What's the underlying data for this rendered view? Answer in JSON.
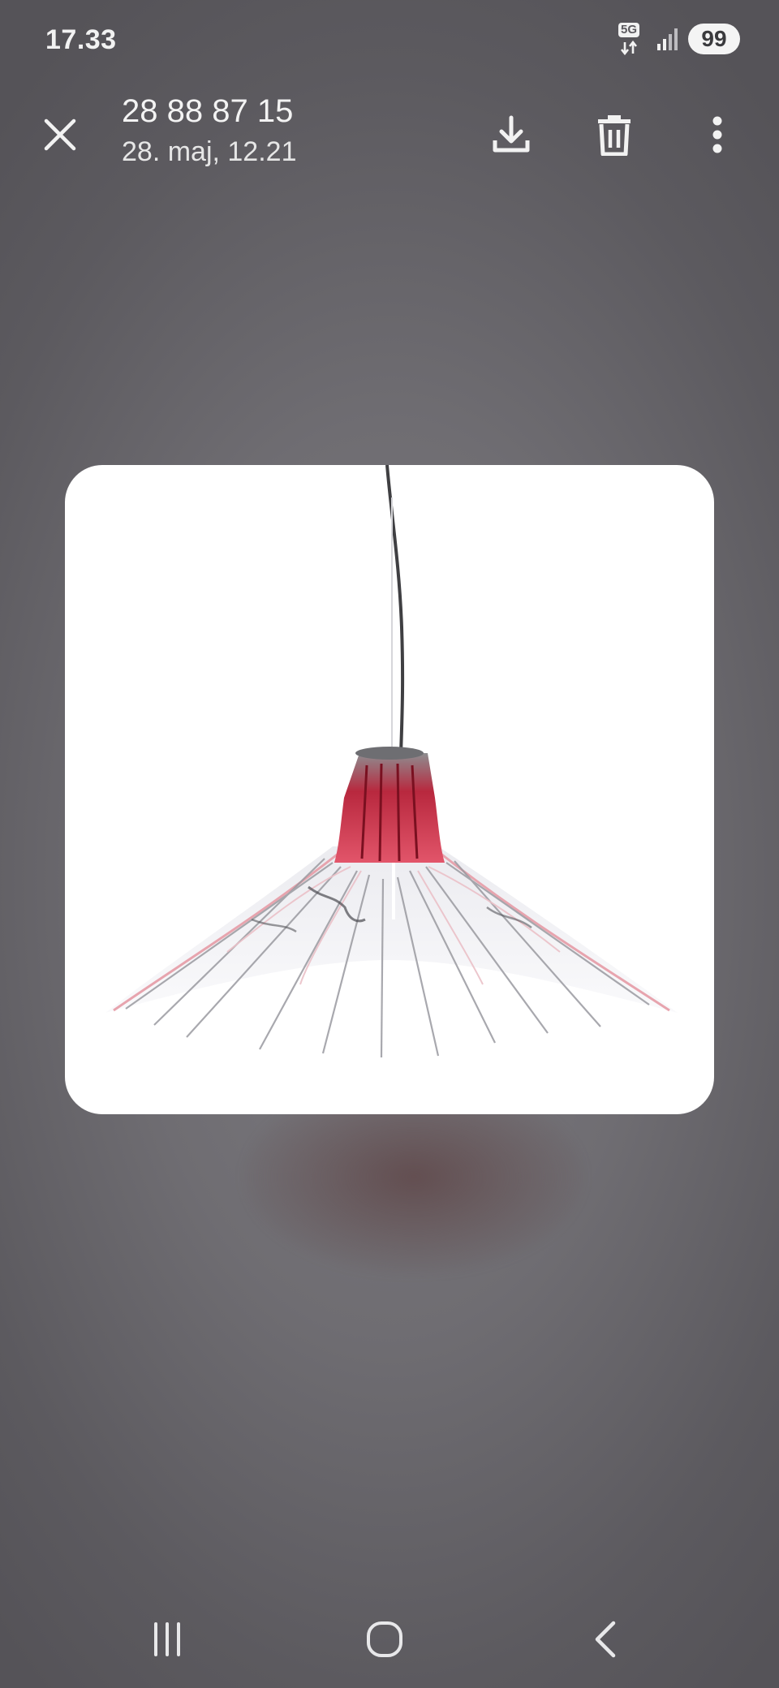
{
  "status_bar": {
    "time": "17.33",
    "network_type": "5G",
    "battery_level": "99",
    "icons": [
      "network-5g-icon",
      "signal-strength-icon",
      "battery-icon"
    ]
  },
  "header": {
    "title": "28 88 87 15",
    "subtitle": "28. maj, 12.21",
    "icons": {
      "close": "close-icon",
      "download": "download-icon",
      "delete": "trash-icon",
      "more": "more-vertical-icon"
    }
  },
  "photo": {
    "subject": "pendant-lamp-image",
    "accent_color": "#d23048"
  },
  "nav_bar": {
    "icons": [
      "recent-apps-icon",
      "home-icon",
      "back-icon"
    ]
  },
  "colors": {
    "background": "#6f6d72",
    "foreground": "#f2f2f2",
    "card": "#ffffff"
  }
}
